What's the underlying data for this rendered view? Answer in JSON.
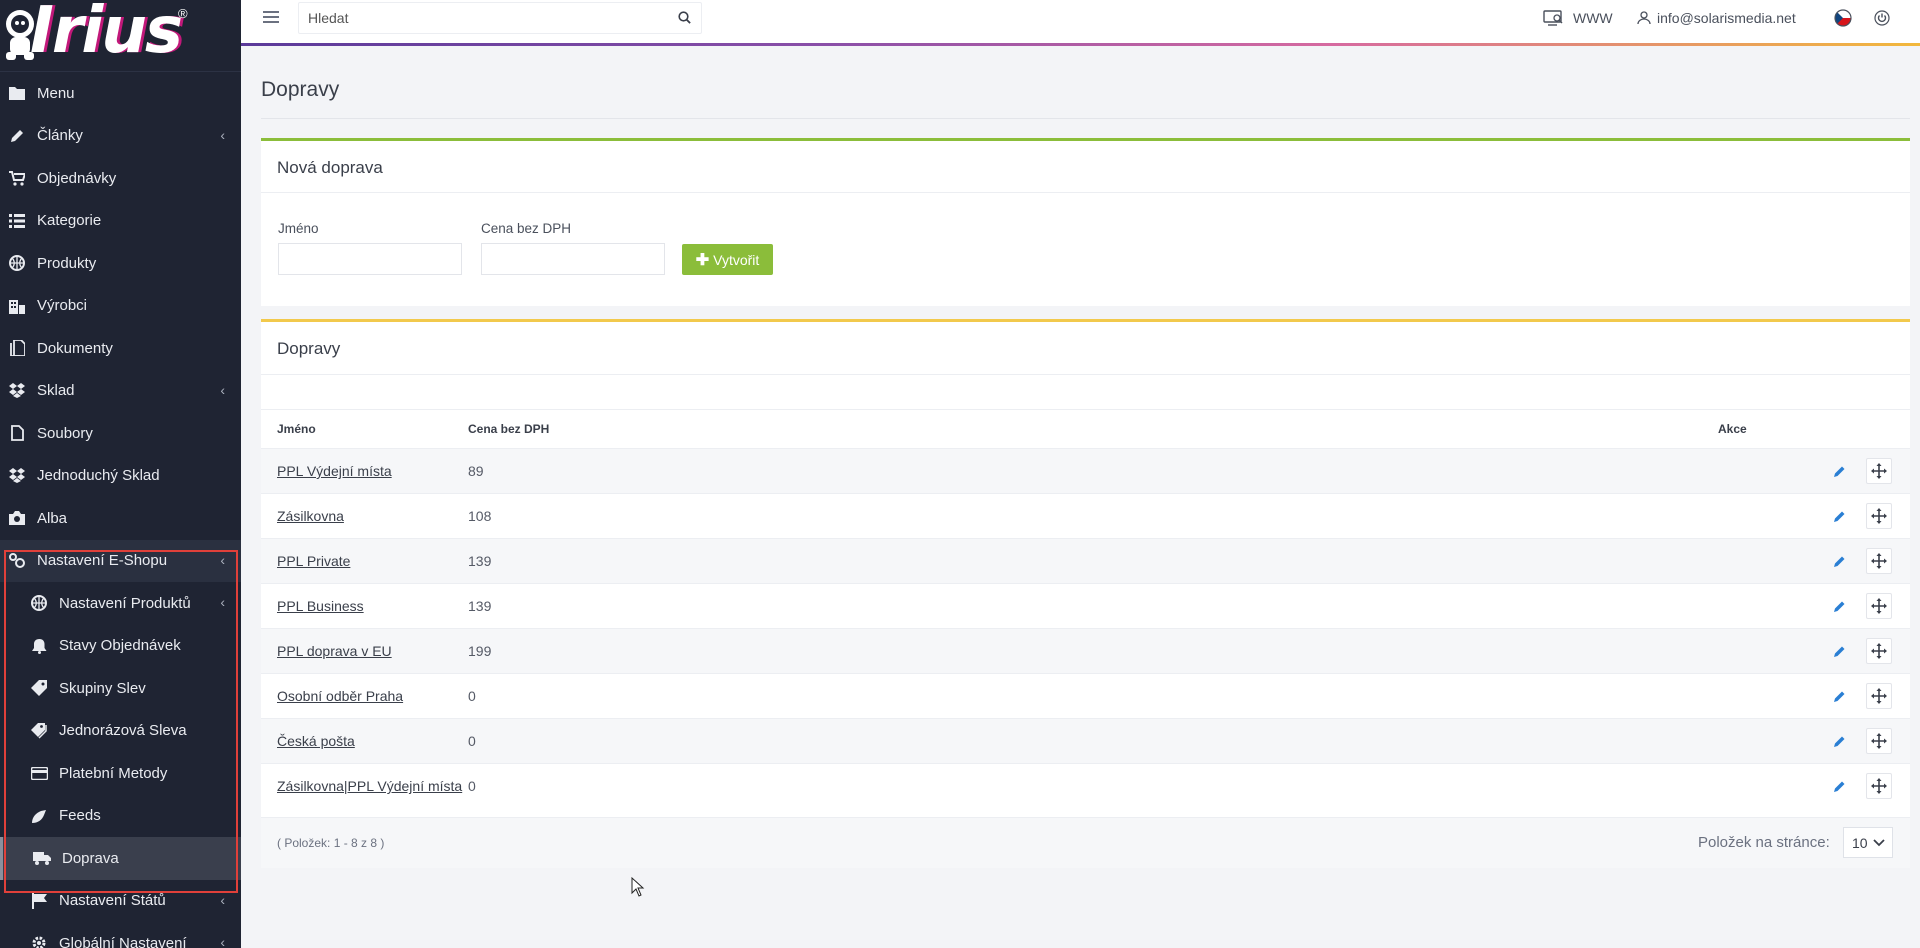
{
  "app": {
    "logo_text": "Irius",
    "logo_mark": "®"
  },
  "sidebar": {
    "items": [
      {
        "label": "Menu",
        "icon": "folder-icon"
      },
      {
        "label": "Články",
        "icon": "pencil-icon",
        "has_children": true
      },
      {
        "label": "Objednávky",
        "icon": "cart-icon"
      },
      {
        "label": "Kategorie",
        "icon": "list-icon"
      },
      {
        "label": "Produkty",
        "icon": "basketball-icon"
      },
      {
        "label": "Výrobci",
        "icon": "building-icon"
      },
      {
        "label": "Dokumenty",
        "icon": "documents-icon"
      },
      {
        "label": "Sklad",
        "icon": "dropbox-icon",
        "has_children": true
      },
      {
        "label": "Soubory",
        "icon": "file-icon"
      },
      {
        "label": "Jednoduchý Sklad",
        "icon": "dropbox-icon"
      },
      {
        "label": "Alba",
        "icon": "camera-icon"
      },
      {
        "label": "Nastavení E-Shopu",
        "icon": "cogs-icon",
        "has_children": true,
        "open": true
      }
    ],
    "subitems": [
      {
        "label": "Nastavení Produktů",
        "icon": "basketball-icon",
        "has_children": true
      },
      {
        "label": "Stavy Objednávek",
        "icon": "bell-icon"
      },
      {
        "label": "Skupiny Slev",
        "icon": "tag-icon"
      },
      {
        "label": "Jednorázová Sleva",
        "icon": "tags-icon"
      },
      {
        "label": "Platební Metody",
        "icon": "credit-card-icon"
      },
      {
        "label": "Feeds",
        "icon": "feed-icon"
      },
      {
        "label": "Doprava",
        "icon": "truck-icon",
        "active": true
      },
      {
        "label": "Nastavení Států",
        "icon": "flag-icon",
        "has_children": true
      },
      {
        "label": "Globální Nastavení",
        "icon": "gear-icon",
        "has_children": true
      }
    ]
  },
  "topbar": {
    "search_placeholder": "Hledat",
    "www_label": "WWW",
    "user_email": "info@solarismedia.net"
  },
  "page": {
    "title": "Dopravy"
  },
  "new_shipping": {
    "title": "Nová doprava",
    "name_label": "Jméno",
    "price_label": "Cena bez DPH",
    "name_value": "",
    "price_value": "",
    "create_label": "Vytvořit"
  },
  "shipping_list": {
    "title": "Dopravy",
    "columns": {
      "name": "Jméno",
      "price": "Cena bez DPH",
      "actions": "Akce"
    },
    "rows": [
      {
        "name": "PPL Výdejní místa",
        "price": "89"
      },
      {
        "name": "Zásilkovna",
        "price": "108"
      },
      {
        "name": "PPL Private",
        "price": "139"
      },
      {
        "name": "PPL Business",
        "price": "139"
      },
      {
        "name": "PPL doprava v EU",
        "price": "199"
      },
      {
        "name": "Osobní odběr Praha",
        "price": "0"
      },
      {
        "name": "Česká pošta",
        "price": "0"
      },
      {
        "name": "Zásilkovna|PPL Výdejní místa",
        "price": "0"
      }
    ],
    "items_info": "( Položek: 1 - 8 z 8 )",
    "per_page_label": "Položek na stránce:",
    "per_page_value": "10"
  },
  "colors": {
    "sidebar_bg": "#1f2433",
    "accent_green": "#8bbd3a",
    "accent_yellow": "#f2c94c",
    "highlight_red": "#e0403a",
    "edit_blue": "#2a7fd4"
  }
}
